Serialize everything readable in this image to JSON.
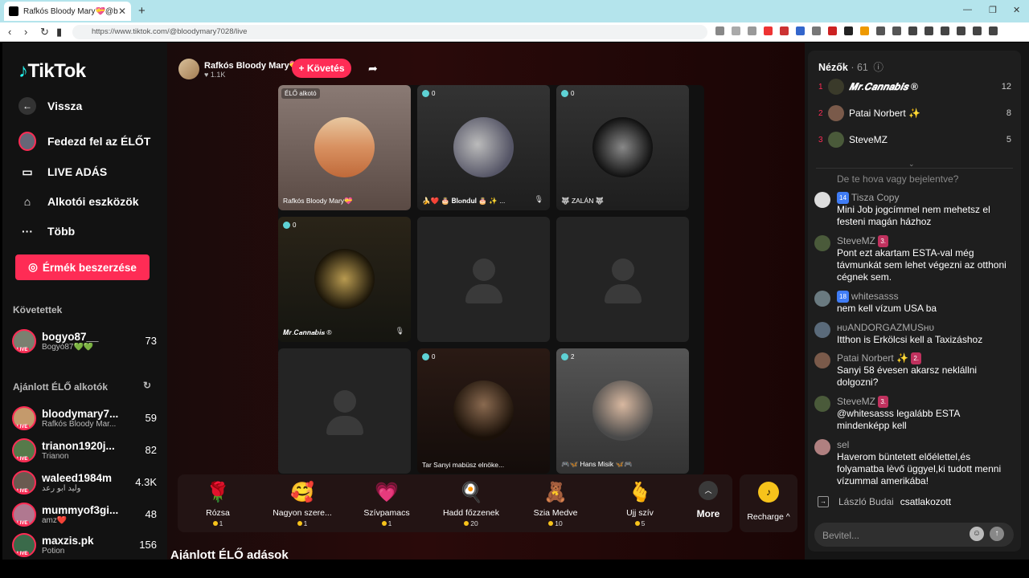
{
  "browser": {
    "tab_title": "Rafkós Bloody Mary💝@bl...",
    "url": "https://www.tiktok.com/@bloodymary7028/live"
  },
  "sidebar": {
    "logo": "TikTok",
    "back": "Vissza",
    "nav": [
      "Fedezd fel az ÉLŐT",
      "LIVE ADÁS",
      "Alkotói eszközök",
      "Több"
    ],
    "coin_button": "Érmék beszerzése",
    "following_header": "Követettek",
    "following": [
      {
        "name": "bogyo87__",
        "sub": "Bogyó87💚💚",
        "count": "73"
      }
    ],
    "recommended_header": "Ajánlott ÉLŐ alkotók",
    "recommended": [
      {
        "name": "bloodymary7...",
        "sub": "Rafkós Bloody Mar...",
        "count": "59"
      },
      {
        "name": "trianon1920j...",
        "sub": "Trianon",
        "count": "82"
      },
      {
        "name": "waleed1984m",
        "sub": "وليد ابو رعد",
        "count": "4.3K"
      },
      {
        "name": "mummyof3gi...",
        "sub": "amz❤️",
        "count": "48"
      },
      {
        "name": "maxzis.pk",
        "sub": "Potion",
        "count": "156"
      }
    ]
  },
  "stream": {
    "host_name": "Rafkós Bloody Mary💝",
    "likes": "♥ 1.1K",
    "follow": "+ Követés",
    "creator_badge": "ÉLŐ alkotó",
    "cells": [
      {
        "name": "Rafkós Bloody Mary💝",
        "viewers": ""
      },
      {
        "name": "🍌❤️ 🎂 𝐁𝐥𝐨𝐧𝐝𝐮𝐥 🎂 ✨ ...",
        "viewers": "0"
      },
      {
        "name": "🐺 ZALÁN 🐺",
        "viewers": "0"
      },
      {
        "name": "𝑴𝒓.𝑪𝒂𝒏𝒏𝒂𝒃𝒊𝒔 ®",
        "viewers": "0"
      },
      {
        "name": "Tar Sanyi mabüsz elnöke...",
        "viewers": "0"
      },
      {
        "name": "🎮🦋 Hans Misik 🦋🎮",
        "viewers": "2"
      }
    ],
    "bottom_title": "Ajánlott ÉLŐ adások"
  },
  "gifts": [
    {
      "name": "Rózsa",
      "price": "1",
      "icon": "🌹"
    },
    {
      "name": "Nagyon szere...",
      "price": "1",
      "icon": "🥰"
    },
    {
      "name": "Szívpamacs",
      "price": "1",
      "icon": "💗"
    },
    {
      "name": "Hadd főzzenek",
      "price": "20",
      "icon": "🍳"
    },
    {
      "name": "Szia Medve",
      "price": "10",
      "icon": "🧸"
    },
    {
      "name": "Ujj szív",
      "price": "5",
      "icon": "🫰"
    }
  ],
  "more_label": "More",
  "recharge_label": "Recharge ^",
  "chat": {
    "viewers_label": "Nézők",
    "viewers_count": "· 61",
    "top": [
      {
        "rank": "1",
        "name": "𝑴𝒓.𝑪𝒂𝒏𝒏𝒂𝒃𝒊𝒔 ®",
        "score": "12",
        "color": "#3a3a2a"
      },
      {
        "rank": "2",
        "name": "Patai Norbert ✨",
        "score": "8",
        "color": "#7a5a4a"
      },
      {
        "rank": "3",
        "name": "SteveMZ",
        "score": "5",
        "color": "#4a5a3a"
      }
    ],
    "messages": [
      {
        "user": "",
        "text": "De te hova vagy bejelentve?",
        "badge": ""
      },
      {
        "user": "Tisza Copy",
        "text": "Mini Job jogcímmel nem mehetsz el festeni magán házhoz",
        "badge": "14"
      },
      {
        "user": "SteveMZ",
        "text": "Pont ezt akartam ESTA-val még távmunkát sem lehet végezni az otthoni cégnek sem.",
        "badge": "3."
      },
      {
        "user": "whitesasss",
        "text": "nem kell vízum USA ba",
        "badge": "18"
      },
      {
        "user": "ʜᴜANDORGAZMUSʜᴜ",
        "text": "Itthon is Erkölcsi kell a Taxizáshoz",
        "badge": ""
      },
      {
        "user": "Patai Norbert ✨",
        "text": "Sanyi 58 évesen akarsz neklállni dolgozni?",
        "badge": "2."
      },
      {
        "user": "SteveMZ",
        "text": "@whitesasss legalább ESTA mindenképp kell",
        "badge": "3."
      },
      {
        "user": "sel",
        "text": "Haverom büntetett előélettel,és folyamatba lèvő üggyel,ki tudott menni vízummal amerikába!",
        "badge": ""
      }
    ],
    "joined_user": "László Budai",
    "joined_text": "csatlakozott",
    "input_placeholder": "Bevitel..."
  }
}
